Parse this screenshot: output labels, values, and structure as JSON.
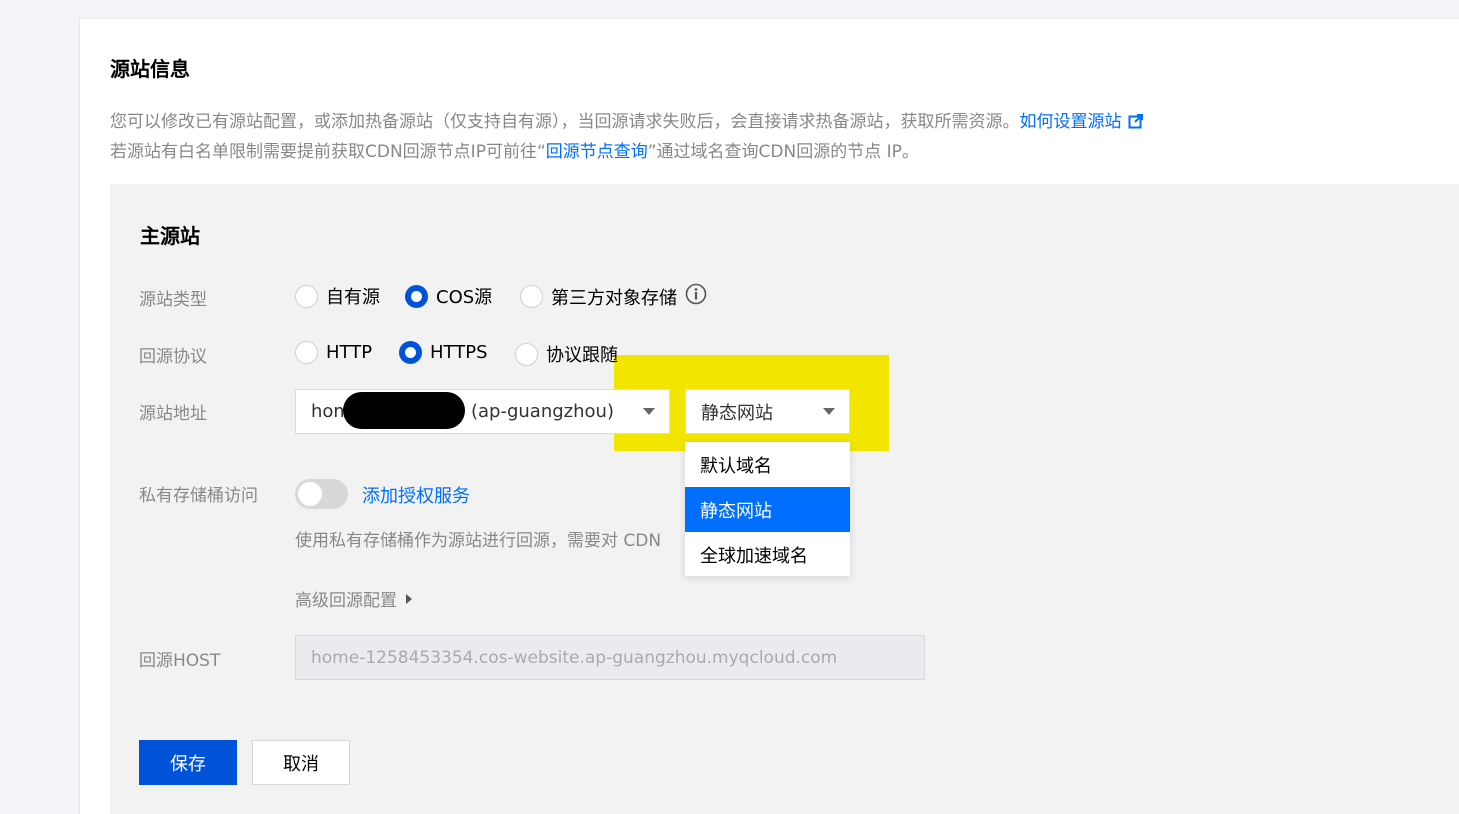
{
  "section": {
    "title": "源站信息",
    "desc_line1": "您可以修改已有源站配置，或添加热备源站（仅支持自有源），当回源请求失败后，会直接请求热备源站，获取所需资源。",
    "desc_link1": "如何设置源站",
    "desc_line2_pre": "若源站有白名单限制需要提前获取CDN回源节点IP可前往“",
    "desc_link2": "回源节点查询",
    "desc_line2_post": "”通过域名查询CDN回源的节点 IP。"
  },
  "primary": {
    "title": "主源站",
    "origin_type": {
      "label": "源站类型",
      "options": [
        "自有源",
        "COS源",
        "第三方对象存储"
      ],
      "selected": "COS源",
      "info_icon": "info-circle-icon"
    },
    "protocol": {
      "label": "回源协议",
      "options": [
        "HTTP",
        "HTTPS",
        "协议跟随"
      ],
      "selected": "HTTPS"
    },
    "address": {
      "label": "源站地址",
      "bucket_prefix": "hom",
      "bucket_suffix": "(ap-guangzhou)",
      "domain_type": "静态网站",
      "dropdown_options": [
        "默认域名",
        "静态网站",
        "全球加速域名"
      ],
      "dropdown_selected": "静态网站"
    },
    "private_bucket": {
      "label": "私有存储桶访问",
      "enabled": false,
      "link": "添加授权服务",
      "hint": "使用私有存储桶作为源站进行回源，需要对 CDN"
    },
    "advanced": {
      "label": "高级回源配置"
    },
    "host": {
      "label": "回源HOST",
      "value": "home-1258453354.cos-website.ap-guangzhou.myqcloud.com"
    }
  },
  "actions": {
    "save": "保存",
    "cancel": "取消"
  },
  "colors": {
    "accent": "#0052d9",
    "link": "#006eff",
    "highlight": "#f2e600",
    "panel_bg": "#f2f2f2"
  }
}
